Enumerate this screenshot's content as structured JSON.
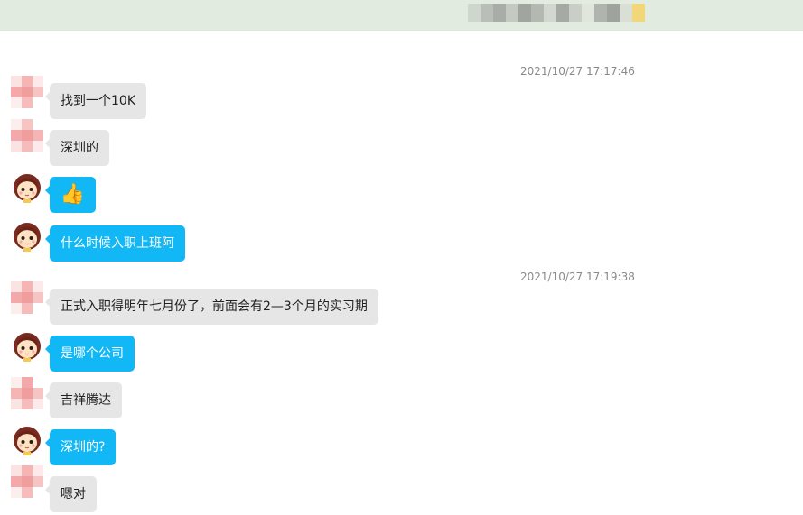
{
  "window": {
    "title": ""
  },
  "colors": {
    "incoming_bubble": "#e6e6e6",
    "outgoing_bubble": "#12b7f5",
    "header": "#e2ebdf"
  },
  "timestamps": [
    "2021/10/27 17:17:46",
    "2021/10/27 17:19:38"
  ],
  "messages": [
    {
      "sender": "contact",
      "text": "找到一个10K"
    },
    {
      "sender": "contact",
      "text": "深圳的"
    },
    {
      "sender": "me",
      "text": "👍",
      "icon": "thumbs-up-icon"
    },
    {
      "sender": "me",
      "text": "什么时候入职上班阿"
    },
    {
      "sender": "contact",
      "text": "正式入职得明年七月份了，前面会有2—3个月的实习期"
    },
    {
      "sender": "me",
      "text": "是哪个公司"
    },
    {
      "sender": "contact",
      "text": "吉祥腾达"
    },
    {
      "sender": "me",
      "text": "深圳的?"
    },
    {
      "sender": "contact",
      "text": "嗯对"
    }
  ]
}
